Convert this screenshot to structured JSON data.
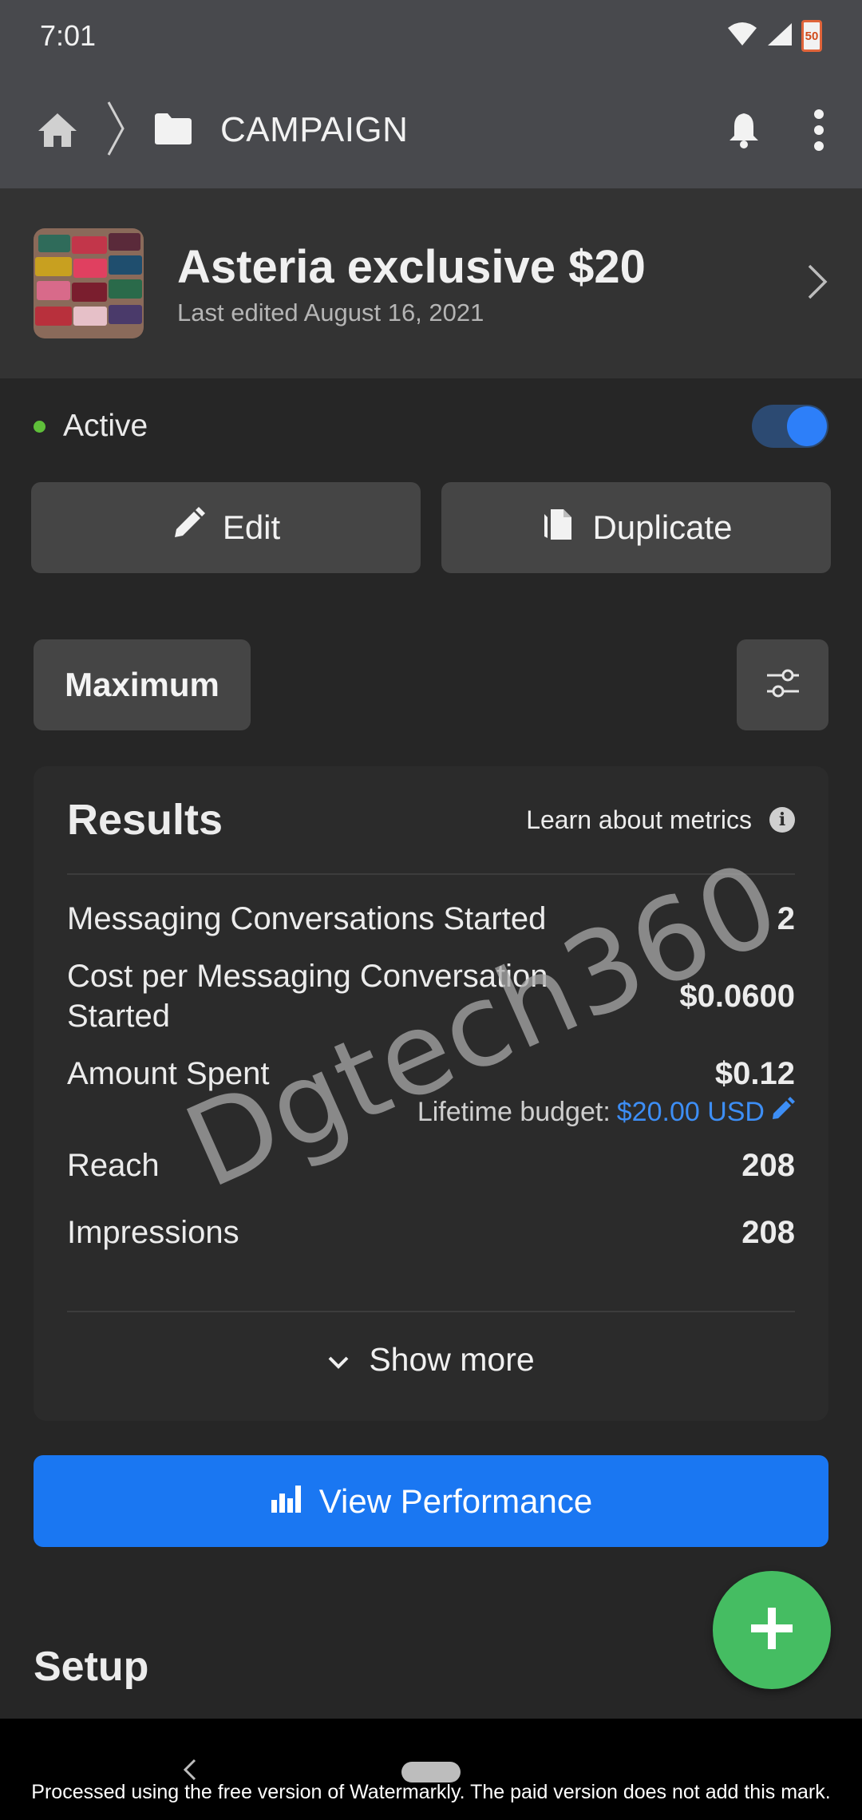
{
  "status_bar": {
    "time": "7:01",
    "battery": "50"
  },
  "nav": {
    "title": "CAMPAIGN"
  },
  "campaign": {
    "name": "Asteria exclusive $20",
    "edited": "Last edited August 16, 2021"
  },
  "status": {
    "label": "Active",
    "enabled": true
  },
  "actions": {
    "edit": "Edit",
    "duplicate": "Duplicate"
  },
  "filters": {
    "range": "Maximum"
  },
  "results": {
    "title": "Results",
    "learn": "Learn about metrics",
    "metrics": [
      {
        "label": "Messaging Conversations Started",
        "value": "2"
      },
      {
        "label": "Cost per Messaging Conversation Started",
        "value": "$0.0600"
      },
      {
        "label": "Amount Spent",
        "value": "$0.12"
      },
      {
        "label": "Reach",
        "value": "208"
      },
      {
        "label": "Impressions",
        "value": "208"
      }
    ],
    "budget_label": "Lifetime budget:",
    "budget_amount": "$20.00 USD",
    "show_more": "Show more"
  },
  "view_performance": "View Performance",
  "setup": "Setup",
  "watermark_text": "Dgtech360",
  "watermark_note": "Processed using the free version of Watermarkly. The paid version does not add this mark.",
  "colors": {
    "accent": "#1a77f2",
    "fab": "#45bd62",
    "active": "#5fbf3a"
  }
}
